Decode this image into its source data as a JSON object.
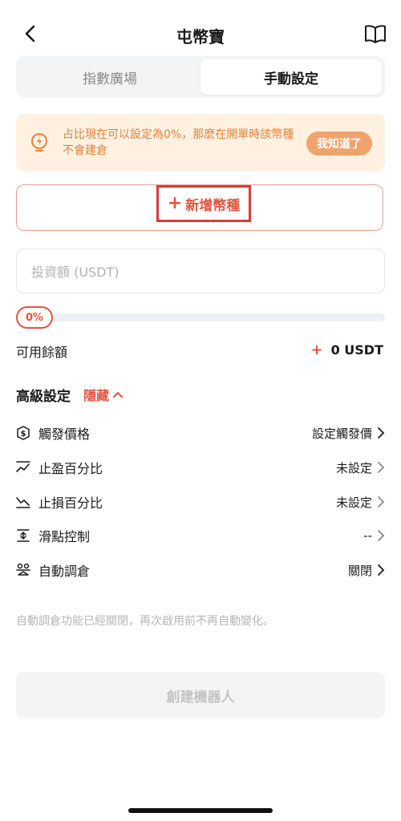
{
  "header": {
    "title": "屯幣寶"
  },
  "tabs": [
    {
      "label": "指數廣場",
      "active": false
    },
    {
      "label": "手動設定",
      "active": true
    }
  ],
  "notice": {
    "text": "占比現在可以設定為0%，那麼在開單時該幣種不會建倉",
    "button": "我知道了"
  },
  "add_coin": {
    "label": "新增幣種"
  },
  "invest": {
    "placeholder": "投資額 (USDT)",
    "value": ""
  },
  "slider": {
    "label": "0%",
    "value_percent": 0
  },
  "balance": {
    "label": "可用餘額",
    "value": "0 USDT"
  },
  "advanced": {
    "title": "高級設定",
    "toggle": "隱藏"
  },
  "settings": [
    {
      "label": "觸發價格",
      "value": "設定觸發價",
      "icon": "dollar-icon"
    },
    {
      "label": "止盈百分比",
      "value": "未設定",
      "icon": "trend-up-icon"
    },
    {
      "label": "止損百分比",
      "value": "未設定",
      "icon": "trend-down-icon"
    },
    {
      "label": "滑點控制",
      "value": "--",
      "icon": "slippage-icon"
    },
    {
      "label": "自動調倉",
      "value": "關閉",
      "icon": "rebalance-icon"
    }
  ],
  "footnote": "自動調倉功能已經關閉，再次啟用前不再自動變化。",
  "create_button": "創建機器人",
  "colors": {
    "accent": "#e4543f",
    "notice_bg": "#fef1e2",
    "notice_text": "#e4833a"
  }
}
